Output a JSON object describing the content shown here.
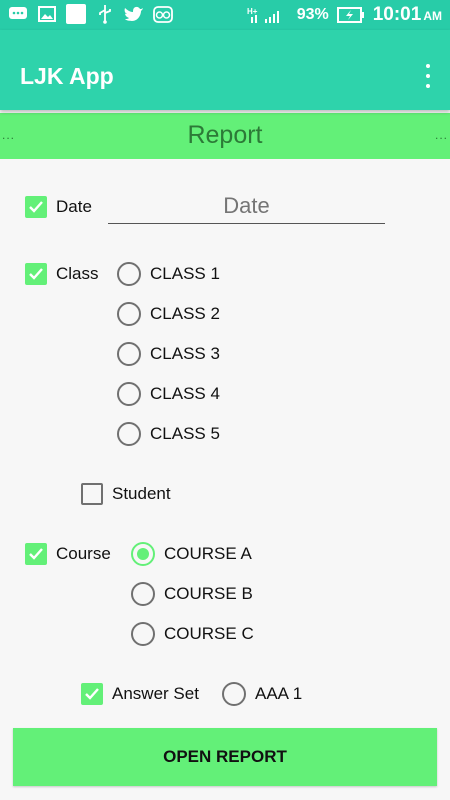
{
  "status_bar": {
    "battery": "93%",
    "network": "H+",
    "time": "10:01",
    "ampm": "AM",
    "icons": [
      "chat-icon",
      "image-icon",
      "white-square-icon",
      "usb-icon",
      "twitter-icon",
      "tripadvisor-icon"
    ]
  },
  "app_bar": {
    "title": "LJK App"
  },
  "report_header": {
    "title": "Report",
    "dots": "..."
  },
  "date": {
    "label": "Date",
    "placeholder": "Date",
    "checked": true
  },
  "class_section": {
    "label": "Class",
    "checked": true,
    "options": [
      "CLASS 1",
      "CLASS 2",
      "CLASS 3",
      "CLASS 4",
      "CLASS 5"
    ]
  },
  "student": {
    "label": "Student",
    "checked": false
  },
  "course_section": {
    "label": "Course",
    "checked": true,
    "options": [
      "COURSE A",
      "COURSE B",
      "COURSE C"
    ],
    "selected": "COURSE A"
  },
  "answer_set": {
    "label": "Answer Set",
    "checked": true,
    "option": "AAA 1"
  },
  "open_button": {
    "label": "OPEN REPORT"
  },
  "colors": {
    "status_bar": "#28cca8",
    "app_bar": "#2ed3ab",
    "accent": "#63f078",
    "report_text": "#2c7a37"
  }
}
